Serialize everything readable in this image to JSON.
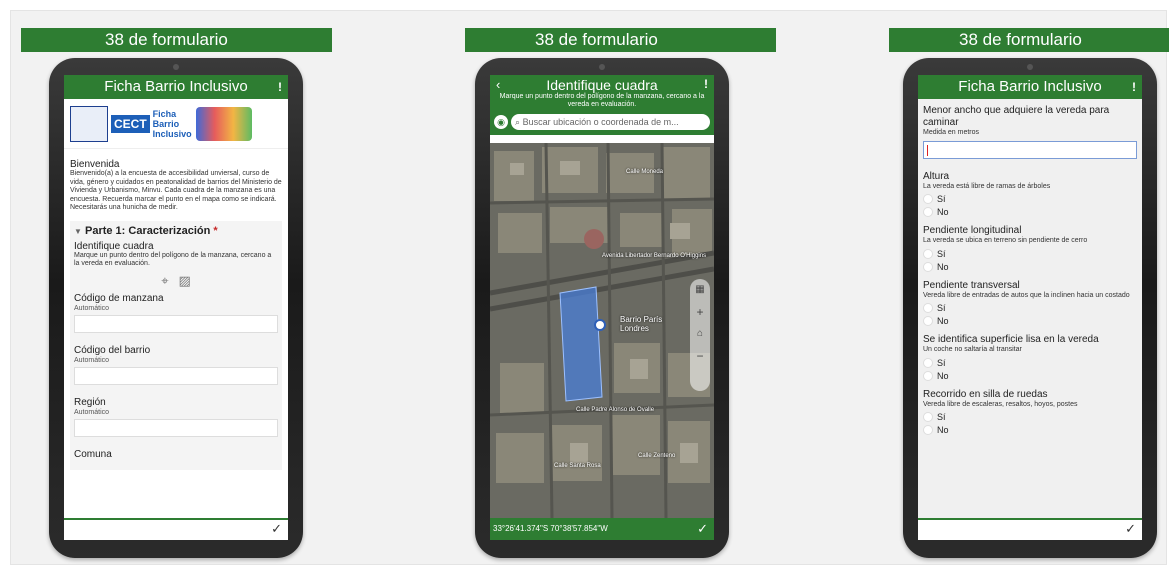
{
  "banner_text": "38 de formulario",
  "panel1": {
    "app_title": "Ficha Barrio Inclusivo",
    "logo_cect": "CECT",
    "logo_ficha": "Ficha",
    "logo_barrio": "Barrio",
    "logo_inclusivo": "Inclusivo",
    "welcome_title": "Bienvenida",
    "welcome_text": "Bienvenido(a) a la encuesta de accesibilidad unviersal, curso de vida, género y cuidados en peatonalidad de barrios del Ministerio de Vivienda y Urbanismo, Minvu. Cada cuadra de la manzana es una encuesta. Recuerda marcar el punto en el mapa como se indicará. Necesitarás una hunicha de medir.",
    "section_title": "Parte 1: Caracterización",
    "section_req": "*",
    "q_location": "Identifique cuadra",
    "q_location_hint": "Marque un punto dentro del polígono de la manzana, cercano a la vereda en evaluación.",
    "fields": [
      {
        "label": "Código de manzana",
        "hint": "Automático"
      },
      {
        "label": "Código del barrio",
        "hint": "Automático"
      },
      {
        "label": "Región",
        "hint": "Automático"
      }
    ],
    "last_label": "Comuna"
  },
  "panel2": {
    "title": "Identifique cuadra",
    "subtitle": "Marque un punto dentro del polígono de la manzana, cercano a la vereda en evaluación.",
    "search_placeholder": "Buscar ubicación o coordenada de m...",
    "map_label": "Barrio París Londres",
    "streets": [
      "Calle Moneda",
      "Avenida Libertador Bernardo O'Higgins",
      "Calle Padre Alonso de Ovalle",
      "Calle Santa Rosa",
      "Calle Zenteno"
    ],
    "coords": "33°26'41.374\"S 70°38'57.854\"W"
  },
  "panel3": {
    "app_title": "Ficha Barrio Inclusivo",
    "q1": "Menor ancho que adquiere la vereda para caminar",
    "q1_hint": "Medida en metros",
    "questions": [
      {
        "label": "Altura",
        "hint": "La vereda está libre de ramas de árboles"
      },
      {
        "label": "Pendiente longitudinal",
        "hint": "La vereda se ubica en terreno sin pendiente de cerro"
      },
      {
        "label": "Pendiente transversal",
        "hint": "Vereda libre de entradas de autos que la inclinen hacia un costado"
      },
      {
        "label": "Se identifica superficie lisa en la vereda",
        "hint": "Un coche no saltaría al transitar"
      },
      {
        "label": "Recorrido en silla de ruedas",
        "hint": "Vereda libre de escaleras, resaltos, hoyos, postes"
      }
    ],
    "opt_yes": "Sí",
    "opt_no": "No"
  }
}
